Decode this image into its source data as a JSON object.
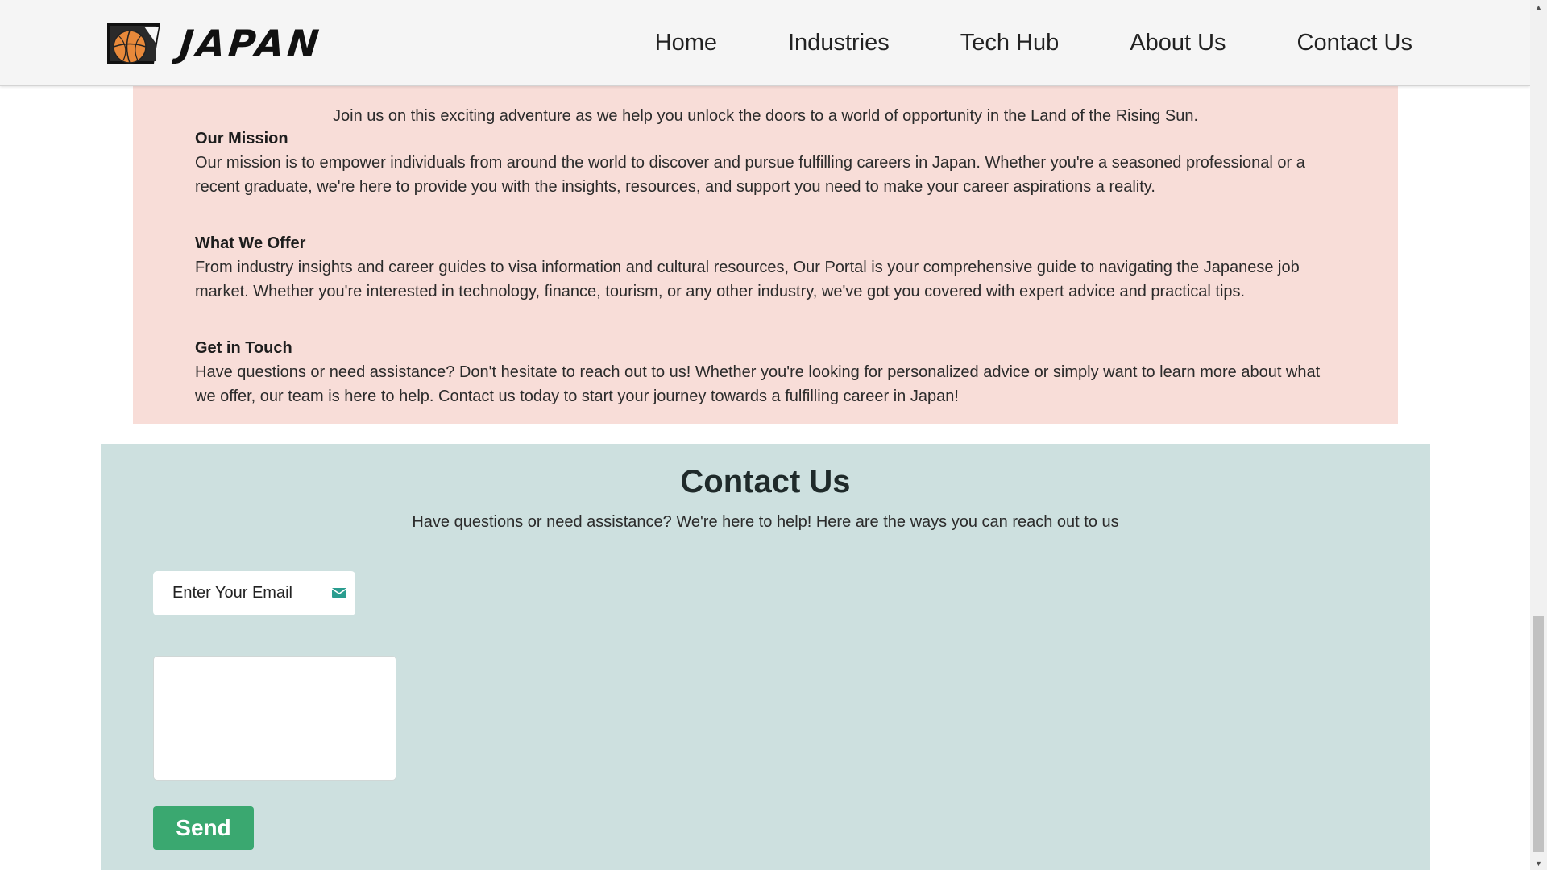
{
  "navbar": {
    "brand_text": "JAPAN",
    "logo_icon": "japan-basketball-logo-icon",
    "links": [
      {
        "label": "Home"
      },
      {
        "label": "Industries"
      },
      {
        "label": "Tech Hub"
      },
      {
        "label": "About Us"
      },
      {
        "label": "Contact Us"
      }
    ]
  },
  "about": {
    "intro": "Join us on this exciting adventure as we help you unlock the doors to a world of opportunity in the Land of the Rising Sun.",
    "mission": {
      "heading": "Our Mission",
      "text": "Our mission is to empower individuals from around the world to discover and pursue fulfilling careers in Japan. Whether you're a seasoned professional or a recent graduate, we're here to provide you with the insights, resources, and support you need to make your career aspirations a reality."
    },
    "offer": {
      "heading": "What We Offer",
      "text": "From industry insights and career guides to visa information and cultural resources, Our Portal is your comprehensive guide to navigating the Japanese job market. Whether you're interested in technology, finance, tourism, or any other industry, we've got you covered with expert advice and practical tips."
    },
    "touch": {
      "heading": "Get in Touch",
      "text": "Have questions or need assistance? Don't hesitate to reach out to us! Whether you're looking for personalized advice or simply want to learn more about what we offer, our team is here to help. Contact us today to start your journey towards a fulfilling career in Japan!"
    }
  },
  "contact": {
    "title": "Contact Us",
    "subtitle": "Have questions or need assistance? We're here to help! Here are the ways you can reach out to us",
    "email_placeholder": "Enter Your Email",
    "email_value": "",
    "message_value": "",
    "send_label": "Send"
  },
  "colors": {
    "navbar_bg": "#f5f5f5",
    "about_bg": "#f8ddd8",
    "contact_bg": "#cde0df",
    "send_button": "#3aa870",
    "mail_icon": "#2a9d8f"
  }
}
